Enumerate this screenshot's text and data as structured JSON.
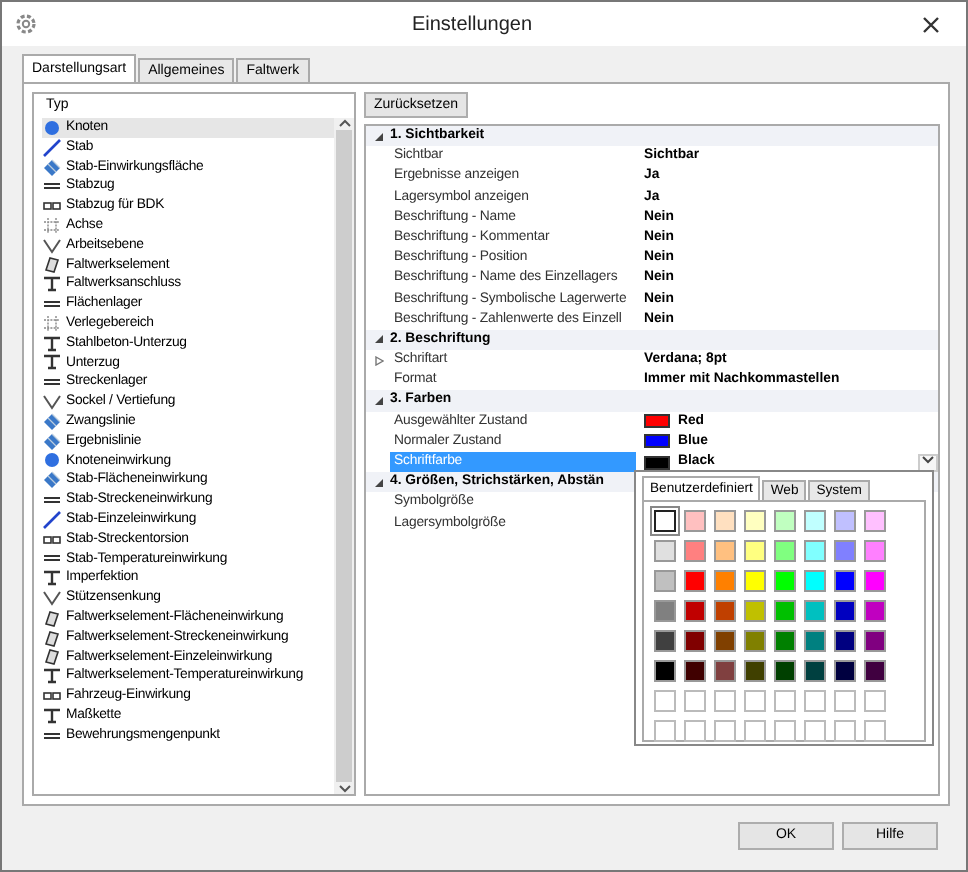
{
  "window": {
    "title": "Einstellungen"
  },
  "tabs": [
    {
      "label": "Darstellungsart",
      "selected": true
    },
    {
      "label": "Allgemeines",
      "selected": false
    },
    {
      "label": "Faltwerk",
      "selected": false
    }
  ],
  "type_list": {
    "header": "Typ",
    "items": [
      {
        "label": "Knoten",
        "selected": true
      },
      {
        "label": "Stab",
        "selected": false
      },
      {
        "label": "Stab-Einwirkungsfläche",
        "selected": false
      },
      {
        "label": "Stabzug",
        "selected": false
      },
      {
        "label": "Stabzug für BDK",
        "selected": false
      },
      {
        "label": "Achse",
        "selected": false
      },
      {
        "label": "Arbeitsebene",
        "selected": false
      },
      {
        "label": "Faltwerkselement",
        "selected": false
      },
      {
        "label": "Faltwerksanschluss",
        "selected": false
      },
      {
        "label": "Flächenlager",
        "selected": false
      },
      {
        "label": "Verlegebereich",
        "selected": false
      },
      {
        "label": "Stahlbeton-Unterzug",
        "selected": false
      },
      {
        "label": "Unterzug",
        "selected": false
      },
      {
        "label": "Streckenlager",
        "selected": false
      },
      {
        "label": "Sockel / Vertiefung",
        "selected": false
      },
      {
        "label": "Zwangslinie",
        "selected": false
      },
      {
        "label": "Ergebnislinie",
        "selected": false
      },
      {
        "label": "Knoteneinwirkung",
        "selected": false
      },
      {
        "label": "Stab-Flächeneinwirkung",
        "selected": false
      },
      {
        "label": "Stab-Streckeneinwirkung",
        "selected": false
      },
      {
        "label": "Stab-Einzeleinwirkung",
        "selected": false
      },
      {
        "label": "Stab-Streckentorsion",
        "selected": false
      },
      {
        "label": "Stab-Temperatureinwirkung",
        "selected": false
      },
      {
        "label": "Imperfektion",
        "selected": false
      },
      {
        "label": "Stützensenkung",
        "selected": false
      },
      {
        "label": "Faltwerkselement-Flächeneinwirkung",
        "selected": false
      },
      {
        "label": "Faltwerkselement-Streckeneinwirkung",
        "selected": false
      },
      {
        "label": "Faltwerkselement-Einzeleinwirkung",
        "selected": false
      },
      {
        "label": "Faltwerkselement-Temperatureinwirkung",
        "selected": false
      },
      {
        "label": "Fahrzeug-Einwirkung",
        "selected": false
      },
      {
        "label": "Maßkette",
        "selected": false
      },
      {
        "label": "Bewehrungsmengenpunkt",
        "selected": false
      }
    ]
  },
  "reset_button": "Zurücksetzen",
  "property_grid": {
    "categories": [
      {
        "title": "1. Sichtbarkeit",
        "expanded": true,
        "properties": [
          {
            "name": "Sichtbar",
            "value": "Sichtbar",
            "selected": false
          },
          {
            "name": "Ergebnisse anzeigen",
            "value": "Ja",
            "selected": false
          },
          {
            "name": "Lagersymbol anzeigen",
            "value": "Ja",
            "selected": false
          },
          {
            "name": "Beschriftung - Name",
            "value": "Nein",
            "selected": false
          },
          {
            "name": "Beschriftung - Kommentar",
            "value": "Nein",
            "selected": false
          },
          {
            "name": "Beschriftung - Position",
            "value": "Nein",
            "selected": false
          },
          {
            "name": "Beschriftung - Name des Einzellagers",
            "value": "Nein",
            "selected": false
          },
          {
            "name": "Beschriftung - Symbolische Lagerwerte",
            "value": "Nein",
            "selected": false
          },
          {
            "name": "Beschriftung - Zahlenwerte des Einzell",
            "value": "Nein",
            "selected": false
          }
        ]
      },
      {
        "title": "2. Beschriftung",
        "expanded": true,
        "properties": [
          {
            "name": "Schriftart",
            "value": "Verdana; 8pt",
            "selected": false,
            "expandable": true
          },
          {
            "name": "Format",
            "value": "Immer mit Nachkommastellen",
            "selected": false
          }
        ]
      },
      {
        "title": "3. Farben",
        "expanded": true,
        "properties": [
          {
            "name": "Ausgewählter Zustand",
            "value": "Red",
            "color": "#ff0000",
            "selected": false
          },
          {
            "name": "Normaler Zustand",
            "value": "Blue",
            "color": "#0000ff",
            "selected": false
          },
          {
            "name": "Schriftfarbe",
            "value": "Black",
            "color": "#000000",
            "selected": true
          }
        ]
      },
      {
        "title": "4. Größen, Strichstärken, Abstän",
        "expanded": true,
        "properties": [
          {
            "name": "Symbolgröße",
            "selected": false
          },
          {
            "name": "Lagersymbolgröße",
            "selected": false
          }
        ]
      }
    ]
  },
  "color_picker": {
    "tabs": [
      {
        "label": "Benutzerdefiniert",
        "selected": true
      },
      {
        "label": "Web",
        "selected": false
      },
      {
        "label": "System",
        "selected": false
      }
    ],
    "swatches": [
      {
        "kind": "color",
        "color": "#ffffff",
        "selected": true
      },
      {
        "kind": "color",
        "color": "#ffc0c0",
        "selected": false
      },
      {
        "kind": "color",
        "color": "#ffe0c0",
        "selected": false
      },
      {
        "kind": "color",
        "color": "#ffffc0",
        "selected": false
      },
      {
        "kind": "color",
        "color": "#c0ffc0",
        "selected": false
      },
      {
        "kind": "color",
        "color": "#c0ffff",
        "selected": false
      },
      {
        "kind": "color",
        "color": "#c0c0ff",
        "selected": false
      },
      {
        "kind": "color",
        "color": "#ffc0ff",
        "selected": false
      },
      {
        "kind": "color",
        "color": "#e0e0e0",
        "selected": false
      },
      {
        "kind": "color",
        "color": "#ff8080",
        "selected": false
      },
      {
        "kind": "color",
        "color": "#ffc080",
        "selected": false
      },
      {
        "kind": "color",
        "color": "#ffff80",
        "selected": false
      },
      {
        "kind": "color",
        "color": "#80ff80",
        "selected": false
      },
      {
        "kind": "color",
        "color": "#80ffff",
        "selected": false
      },
      {
        "kind": "color",
        "color": "#8080ff",
        "selected": false
      },
      {
        "kind": "color",
        "color": "#ff80ff",
        "selected": false
      },
      {
        "kind": "color",
        "color": "#c0c0c0",
        "selected": false
      },
      {
        "kind": "color",
        "color": "#ff0000",
        "selected": false
      },
      {
        "kind": "color",
        "color": "#ff8000",
        "selected": false
      },
      {
        "kind": "color",
        "color": "#ffff00",
        "selected": false
      },
      {
        "kind": "color",
        "color": "#00ff00",
        "selected": false
      },
      {
        "kind": "color",
        "color": "#00ffff",
        "selected": false
      },
      {
        "kind": "color",
        "color": "#0000ff",
        "selected": false
      },
      {
        "kind": "color",
        "color": "#ff00ff",
        "selected": false
      },
      {
        "kind": "color",
        "color": "#808080",
        "selected": false
      },
      {
        "kind": "color",
        "color": "#c00000",
        "selected": false
      },
      {
        "kind": "color",
        "color": "#c04000",
        "selected": false
      },
      {
        "kind": "color",
        "color": "#c0c000",
        "selected": false
      },
      {
        "kind": "color",
        "color": "#00c000",
        "selected": false
      },
      {
        "kind": "color",
        "color": "#00c0c0",
        "selected": false
      },
      {
        "kind": "color",
        "color": "#0000c0",
        "selected": false
      },
      {
        "kind": "color",
        "color": "#c000c0",
        "selected": false
      },
      {
        "kind": "color",
        "color": "#404040",
        "selected": false
      },
      {
        "kind": "color",
        "color": "#800000",
        "selected": false
      },
      {
        "kind": "color",
        "color": "#804000",
        "selected": false
      },
      {
        "kind": "color",
        "color": "#808000",
        "selected": false
      },
      {
        "kind": "color",
        "color": "#008000",
        "selected": false
      },
      {
        "kind": "color",
        "color": "#008080",
        "selected": false
      },
      {
        "kind": "color",
        "color": "#000080",
        "selected": false
      },
      {
        "kind": "color",
        "color": "#800080",
        "selected": false
      },
      {
        "kind": "color",
        "color": "#000000",
        "selected": false
      },
      {
        "kind": "color",
        "color": "#400000",
        "selected": false
      },
      {
        "kind": "color",
        "color": "#804040",
        "selected": false
      },
      {
        "kind": "color",
        "color": "#404000",
        "selected": false
      },
      {
        "kind": "color",
        "color": "#004000",
        "selected": false
      },
      {
        "kind": "color",
        "color": "#004040",
        "selected": false
      },
      {
        "kind": "color",
        "color": "#000040",
        "selected": false
      },
      {
        "kind": "color",
        "color": "#400040",
        "selected": false
      },
      {
        "kind": "empty",
        "selected": false
      },
      {
        "kind": "empty",
        "selected": false
      },
      {
        "kind": "empty",
        "selected": false
      },
      {
        "kind": "empty",
        "selected": false
      },
      {
        "kind": "empty",
        "selected": false
      },
      {
        "kind": "empty",
        "selected": false
      },
      {
        "kind": "empty",
        "selected": false
      },
      {
        "kind": "empty",
        "selected": false
      },
      {
        "kind": "empty",
        "selected": false
      },
      {
        "kind": "empty",
        "selected": false
      },
      {
        "kind": "empty",
        "selected": false
      },
      {
        "kind": "empty",
        "selected": false
      },
      {
        "kind": "empty",
        "selected": false
      },
      {
        "kind": "empty",
        "selected": false
      },
      {
        "kind": "empty",
        "selected": false
      },
      {
        "kind": "empty",
        "selected": false
      }
    ]
  },
  "buttons": [
    "OK",
    "Hilfe"
  ]
}
